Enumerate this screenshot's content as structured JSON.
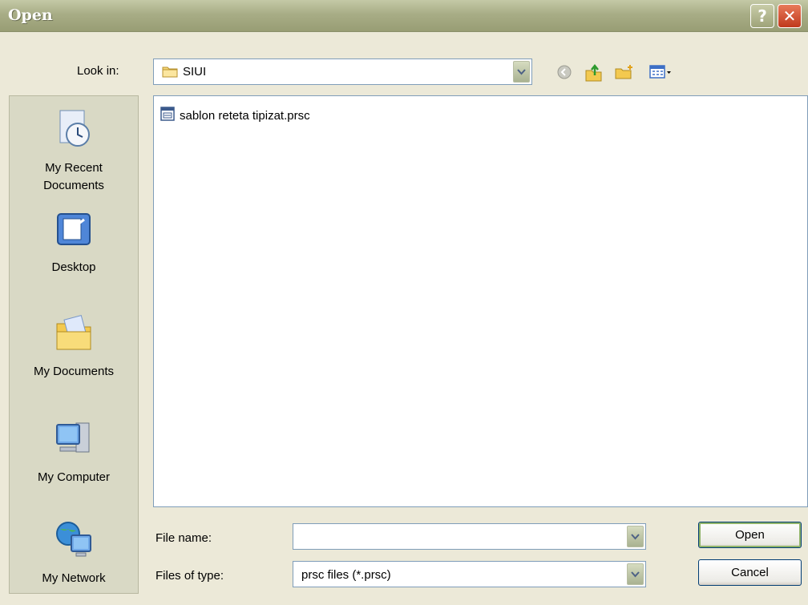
{
  "window": {
    "title": "Open",
    "help_symbol": "?",
    "close_symbol": "✕"
  },
  "look_in": {
    "label": "Look in:",
    "value": "SIUI"
  },
  "toolbar": {
    "icons": [
      "back-icon",
      "up-folder-icon",
      "new-folder-icon",
      "views-menu-icon"
    ]
  },
  "places": [
    {
      "label_line1": "My Recent",
      "label_line2": "Documents",
      "icon": "recent-documents-icon"
    },
    {
      "label_line1": "Desktop",
      "label_line2": "",
      "icon": "desktop-icon"
    },
    {
      "label_line1": "My Documents",
      "label_line2": "",
      "icon": "my-documents-icon"
    },
    {
      "label_line1": "My Computer",
      "label_line2": "",
      "icon": "my-computer-icon"
    },
    {
      "label_line1": "My Network",
      "label_line2": "",
      "icon": "my-network-icon"
    }
  ],
  "files": [
    {
      "name": "sablon reteta tipizat.prsc",
      "icon": "document-file-icon"
    }
  ],
  "file_name": {
    "label": "File name:",
    "value": ""
  },
  "file_type": {
    "label": "Files of type:",
    "value": "prsc files (*.prsc)"
  },
  "buttons": {
    "open": "Open",
    "cancel": "Cancel"
  },
  "colors": {
    "titlebar": "#a8ad86",
    "panel": "#ece9d8",
    "close": "#c0391d",
    "border": "#7f9db9"
  }
}
